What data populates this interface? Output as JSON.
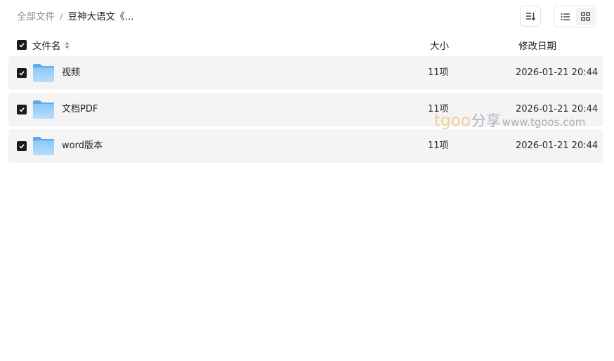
{
  "breadcrumb": {
    "root": "全部文件",
    "separator": "/",
    "current": "豆神大语文《..."
  },
  "toolbar": {
    "sort_icon": "sort-icon",
    "list_view_icon": "list-view-icon",
    "grid_view_icon": "grid-view-icon",
    "active_view": "list"
  },
  "table": {
    "header_checked": true,
    "columns": {
      "name": "文件名",
      "size": "大小",
      "modified": "修改日期"
    },
    "rows": [
      {
        "name": "视频",
        "size": "11项",
        "modified": "2026-01-21 20:44",
        "checked": true,
        "icon": "folder-icon"
      },
      {
        "name": "文档PDF",
        "size": "11项",
        "modified": "2026-01-21 20:44",
        "checked": true,
        "icon": "folder-icon"
      },
      {
        "name": "word版本",
        "size": "11项",
        "modified": "2026-01-21 20:44",
        "checked": true,
        "icon": "folder-icon"
      }
    ]
  },
  "watermark": {
    "brand": "tgoo",
    "share": "分享",
    "url": "www.tgoos.com"
  },
  "colors": {
    "row_bg": "#f4f4f5",
    "checkbox": "#1a1a1a",
    "folder": "#7dbbf2",
    "muted_text": "#8a8f99"
  }
}
